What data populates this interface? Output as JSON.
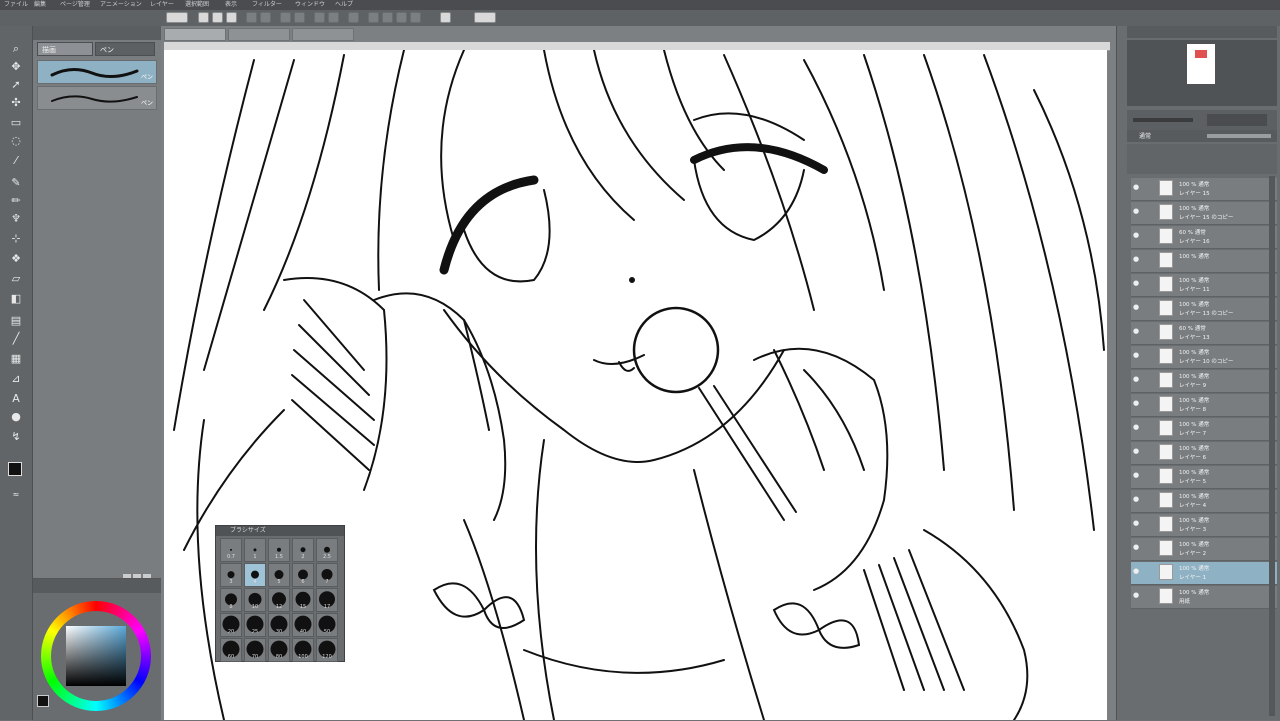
{
  "menu": [
    "ファイル",
    "編集",
    "ページ管理",
    "アニメーション",
    "レイヤー",
    "選択範囲",
    "表示",
    "フィルター",
    "ウィンドウ",
    "ヘルプ"
  ],
  "subtool": {
    "tabs": [
      "描画",
      "ペン"
    ],
    "brushes": [
      {
        "name": "ペン"
      },
      {
        "name": "ペン"
      }
    ]
  },
  "document": {
    "tabs": [
      "",
      "",
      ""
    ]
  },
  "brush_size_palette": {
    "title": "ブラシサイズ",
    "rows": [
      [
        "0.7",
        "1",
        "1.5",
        "2",
        "2.5"
      ],
      [
        "3",
        "4",
        "5",
        "6",
        "7"
      ],
      [
        "8",
        "10",
        "12",
        "15",
        "17"
      ],
      [
        "20",
        "25",
        "30",
        "40",
        "50"
      ],
      [
        "60",
        "70",
        "80",
        "100",
        "120"
      ]
    ],
    "selected": "4"
  },
  "layers": [
    {
      "opacity": "100 % 通常",
      "name": "レイヤー 15"
    },
    {
      "opacity": "100 % 通常",
      "name": "レイヤー 15 のコピー"
    },
    {
      "opacity": "60 % 通常",
      "name": "レイヤー 16"
    },
    {
      "opacity": "100 % 通常",
      "name": ""
    },
    {
      "opacity": "100 % 通常",
      "name": "レイヤー 11"
    },
    {
      "opacity": "100 % 通常",
      "name": "レイヤー 13 のコピー"
    },
    {
      "opacity": "60 % 通常",
      "name": "レイヤー 13"
    },
    {
      "opacity": "100 % 通常",
      "name": "レイヤー 10 のコピー"
    },
    {
      "opacity": "100 % 通常",
      "name": "レイヤー 9"
    },
    {
      "opacity": "100 % 通常",
      "name": "レイヤー 8"
    },
    {
      "opacity": "100 % 通常",
      "name": "レイヤー 7"
    },
    {
      "opacity": "100 % 通常",
      "name": "レイヤー 6"
    },
    {
      "opacity": "100 % 通常",
      "name": "レイヤー 5"
    },
    {
      "opacity": "100 % 通常",
      "name": "レイヤー 4"
    },
    {
      "opacity": "100 % 通常",
      "name": "レイヤー 3"
    },
    {
      "opacity": "100 % 通常",
      "name": "レイヤー 2"
    },
    {
      "opacity": "100 % 通常",
      "name": "レイヤー 1"
    },
    {
      "opacity": "100 % 通常",
      "name": "用紙"
    }
  ],
  "layer_panel": {
    "blend_mode": "通常"
  },
  "colors": {
    "accent": "#8fb1c4",
    "main": "#111111",
    "sub": "#f4b9a8"
  }
}
